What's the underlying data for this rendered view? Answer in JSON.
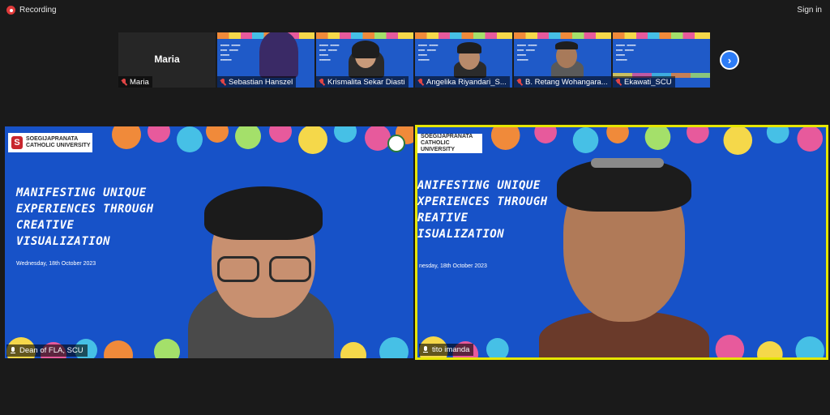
{
  "topbar": {
    "recording_label": "Recording",
    "sign_in_label": "Sign in"
  },
  "gallery": {
    "participants": [
      {
        "name": "Maria",
        "display_name": "Maria",
        "video": false
      },
      {
        "name": "Sebastian Hanszel",
        "video": true
      },
      {
        "name": "Krismalita Sekar Diasti",
        "video": true
      },
      {
        "name": "Angelika Riyandari_S...",
        "video": true
      },
      {
        "name": "B. Retang Wohangara...",
        "video": true
      },
      {
        "name": "Ekawati_SCU",
        "video": true
      }
    ],
    "next_icon": "chevron-right-icon"
  },
  "slide": {
    "university_line1": "SOEGIJAPRANATA",
    "university_line2": "CATHOLIC UNIVERSITY",
    "title_lines": [
      "Manifesting Unique",
      "Experiences Through",
      "Creative",
      "Visualization"
    ],
    "title_lines_right": [
      "anifesting Unique",
      "xperiences Through",
      "reative",
      "isualization"
    ],
    "date": "Wednesday, 18th October 2023",
    "date_right": "nesday, 18th October 2023"
  },
  "speakers": [
    {
      "name": "Dean of FLA, SCU"
    },
    {
      "name": "tito imanda"
    }
  ],
  "colors": {
    "slide_blue": "#1752c8",
    "active_speaker_border": "#e6e600",
    "recording_red": "#e03a3a",
    "mic_muted_red": "#e04545"
  }
}
